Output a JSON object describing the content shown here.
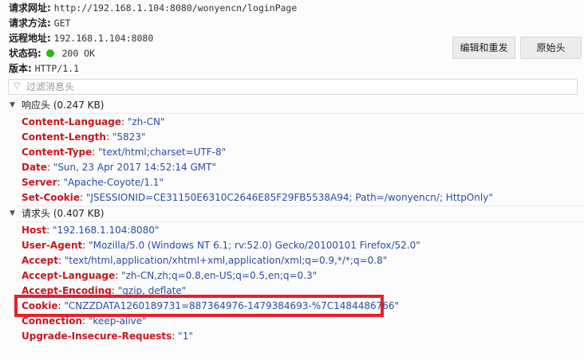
{
  "summary": {
    "request_url_label": "请求网址:",
    "request_url": "http://192.168.1.104:8080/wonyencn/loginPage",
    "method_label": "请求方法:",
    "method": "GET",
    "remote_label": "远程地址:",
    "remote": "192.168.1.104:8080",
    "status_label": "状态码:",
    "status": "200 OK",
    "version_label": "版本:",
    "version": "HTTP/1.1"
  },
  "buttons": {
    "edit_resend": "编辑和重发",
    "raw_headers": "原始头"
  },
  "filter": {
    "placeholder": "过滤消息头"
  },
  "response": {
    "title": "响应头 (0.247 KB)",
    "headers": [
      {
        "name": "Content-Language",
        "value": "\"zh-CN\""
      },
      {
        "name": "Content-Length",
        "value": "\"5823\""
      },
      {
        "name": "Content-Type",
        "value": "\"text/html;charset=UTF-8\""
      },
      {
        "name": "Date",
        "value": "\"Sun, 23 Apr 2017 14:52:14 GMT\""
      },
      {
        "name": "Server",
        "value": "\"Apache-Coyote/1.1\""
      },
      {
        "name": "Set-Cookie",
        "value": "\"JSESSIONID=CE31150E6310C2646E85F29FB5538A94; Path=/wonyencn/; HttpOnly\""
      }
    ]
  },
  "request": {
    "title": "请求头 (0.407 KB)",
    "headers": [
      {
        "name": "Host",
        "value": "\"192.168.1.104:8080\""
      },
      {
        "name": "User-Agent",
        "value": "\"Mozilla/5.0 (Windows NT 6.1; rv:52.0) Gecko/20100101 Firefox/52.0\""
      },
      {
        "name": "Accept",
        "value": "\"text/html,application/xhtml+xml,application/xml;q=0.9,*/*;q=0.8\""
      },
      {
        "name": "Accept-Language",
        "value": "\"zh-CN,zh;q=0.8,en-US;q=0.5,en;q=0.3\""
      },
      {
        "name": "Accept-Encoding",
        "value": "\"gzip, deflate\""
      },
      {
        "name": "Cookie",
        "value": "\"CNZZDATA1260189731=887364976-1479384693-%7C1484486766\""
      },
      {
        "name": "Connection",
        "value": "\"keep-alive\""
      },
      {
        "name": "Upgrade-Insecure-Requests",
        "value": "\"1\""
      }
    ]
  },
  "colors": {
    "header_name": "#c9161e",
    "header_value": "#2a4ea3",
    "highlight_border": "#e8202a",
    "status_ok": "#2cbb0f"
  }
}
